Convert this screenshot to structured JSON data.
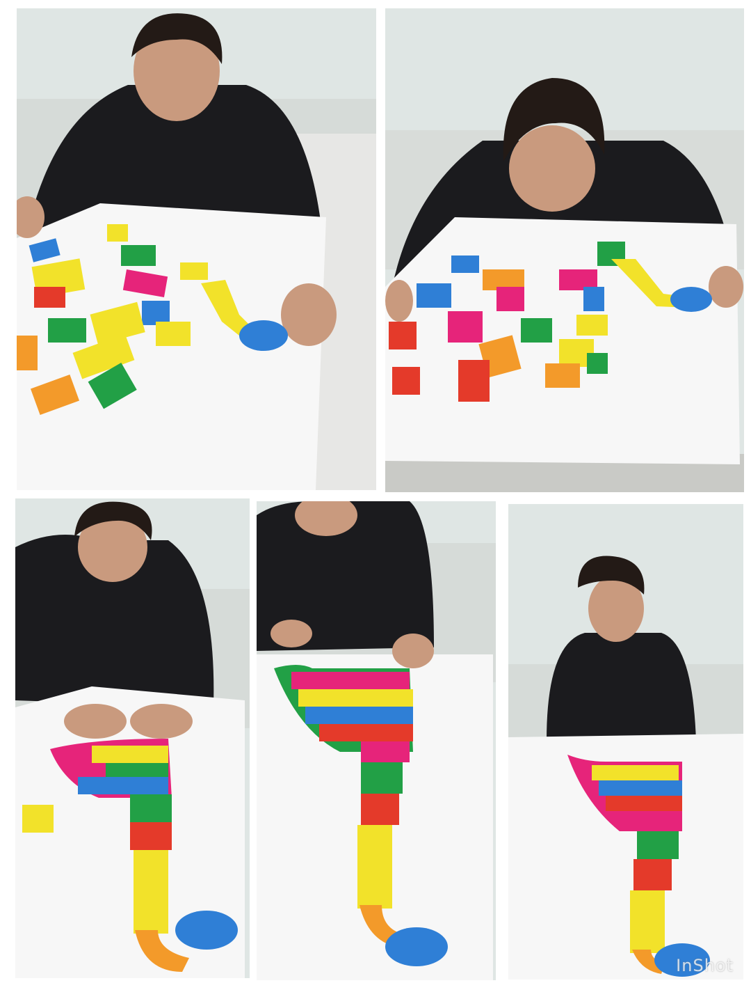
{
  "collage": {
    "panels": [
      {
        "id": "p1",
        "subject": "boy-sorting-puzzle-pieces"
      },
      {
        "id": "p2",
        "subject": "boy-leaning-over-puzzle-pieces"
      },
      {
        "id": "p3",
        "subject": "boy-assembling-puzzle"
      },
      {
        "id": "p4",
        "subject": "boy-with-completed-puzzle"
      },
      {
        "id": "p5",
        "subject": "boy-smiling-with-completed-puzzle"
      }
    ],
    "watermark": "InShot"
  },
  "colors": {
    "wall": "#dfe6e4",
    "table": "#f7f7f7",
    "hoodie": "#1b1b1e",
    "hair": "#231a16",
    "skin": "#c99a7e",
    "puzzle_blue": "#2f7fd6",
    "puzzle_yellow": "#f2e22a",
    "puzzle_green": "#22a046",
    "puzzle_pink": "#e6247a",
    "puzzle_red": "#e43a2a",
    "puzzle_orange": "#f39a2a"
  }
}
